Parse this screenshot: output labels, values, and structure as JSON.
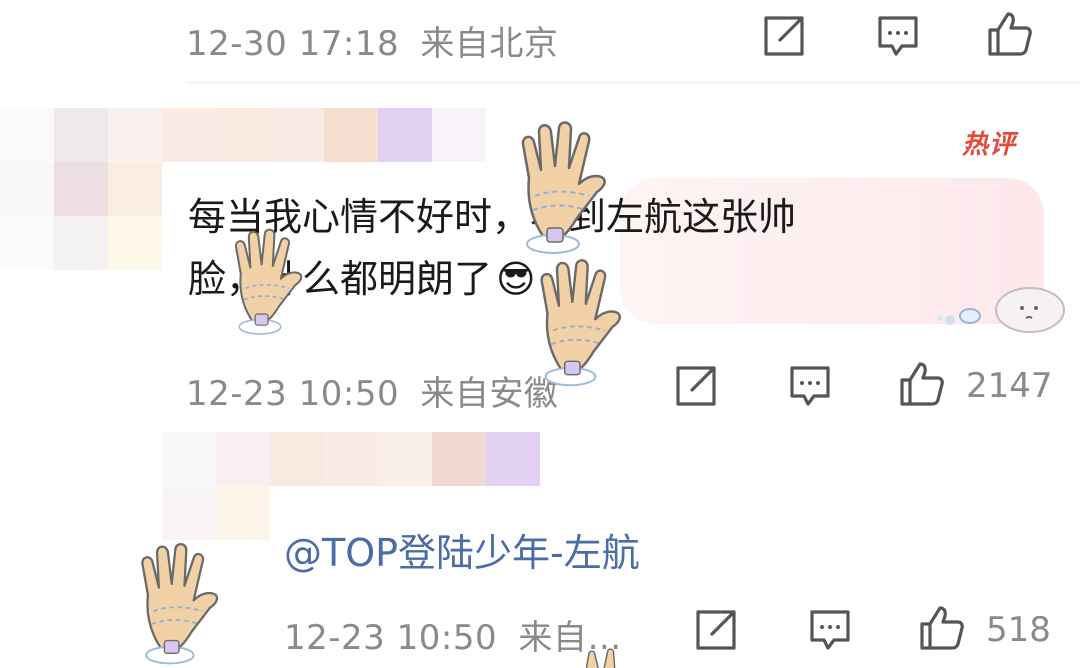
{
  "top_comment": {
    "timestamp": "12-30 17:18",
    "location": "来自北京"
  },
  "hot_comment": {
    "badge": "热评",
    "text_line1": "每当我心情不好时，看到左航这张帅",
    "text_line2": "脸，什么都明朗了",
    "emoji": "😎",
    "timestamp": "12-23 10:50",
    "location": "来自安徽",
    "like_count": "2147"
  },
  "reply": {
    "mention": "@TOP登陆少年-左航",
    "timestamp": "12-23 10:50",
    "location": "来自…",
    "like_count": "518"
  },
  "icons": {
    "share": "share-icon",
    "comment": "comment-icon",
    "like": "thumbs-up-icon",
    "glove": "glove-sticker",
    "decor": "cartoon-decoration"
  },
  "colors": {
    "meta": "#8a8a8a",
    "mention": "#4a6da7",
    "hot": "#e8483b",
    "bubble": "#fde8ec"
  }
}
